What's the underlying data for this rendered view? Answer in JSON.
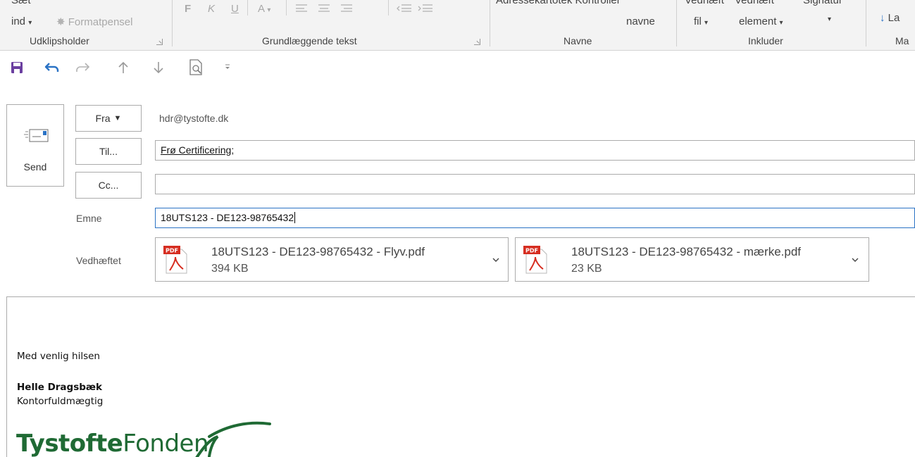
{
  "ribbon": {
    "insert_top": "Sæt",
    "insert_bottom": "ind",
    "format_painter": "Formatpensel",
    "bold": "F",
    "italic": "K",
    "underline": "U",
    "font_color": "A",
    "addressbook_top": "Adressekartotek Kontroller",
    "check_names": "navne",
    "attach_top": "Vedhæft",
    "attach_file": "fil",
    "attach_item_top": "Vedhæft",
    "attach_item": "element",
    "signature_top": "Signatur",
    "low_importance": "La",
    "groups": {
      "clipboard": "Udklipsholder",
      "basic_text": "Grundlæggende tekst",
      "names": "Navne",
      "include": "Inkluder",
      "tags": "Ma"
    }
  },
  "compose": {
    "send_label": "Send",
    "from_button": "Fra",
    "from_value": "hdr@tystofte.dk",
    "to_button": "Til...",
    "to_value": "Frø Certificering",
    "to_separator": ";",
    "cc_button": "Cc...",
    "cc_value": "",
    "subject_label": "Emne",
    "subject_value": "18UTS123 - DE123-98765432",
    "attached_label": "Vedhæftet",
    "attachments": [
      {
        "name": "18UTS123 - DE123-98765432 - Flyv.pdf",
        "size": "394 KB",
        "badge": "PDF"
      },
      {
        "name": "18UTS123 - DE123-98765432 - mærke.pdf",
        "size": "23 KB",
        "badge": "PDF"
      }
    ]
  },
  "signature": {
    "greeting": "Med venlig hilsen",
    "name": "Helle Dragsbæk",
    "title": "Kontorfuldmægtig",
    "logo_bold": "Tystofte",
    "logo_regular": "Fonden"
  },
  "colors": {
    "accent_blue": "#2b73c5",
    "save_purple": "#6b3fa0",
    "pdf_red": "#d62d20",
    "logo_green": "#1f6a34"
  }
}
